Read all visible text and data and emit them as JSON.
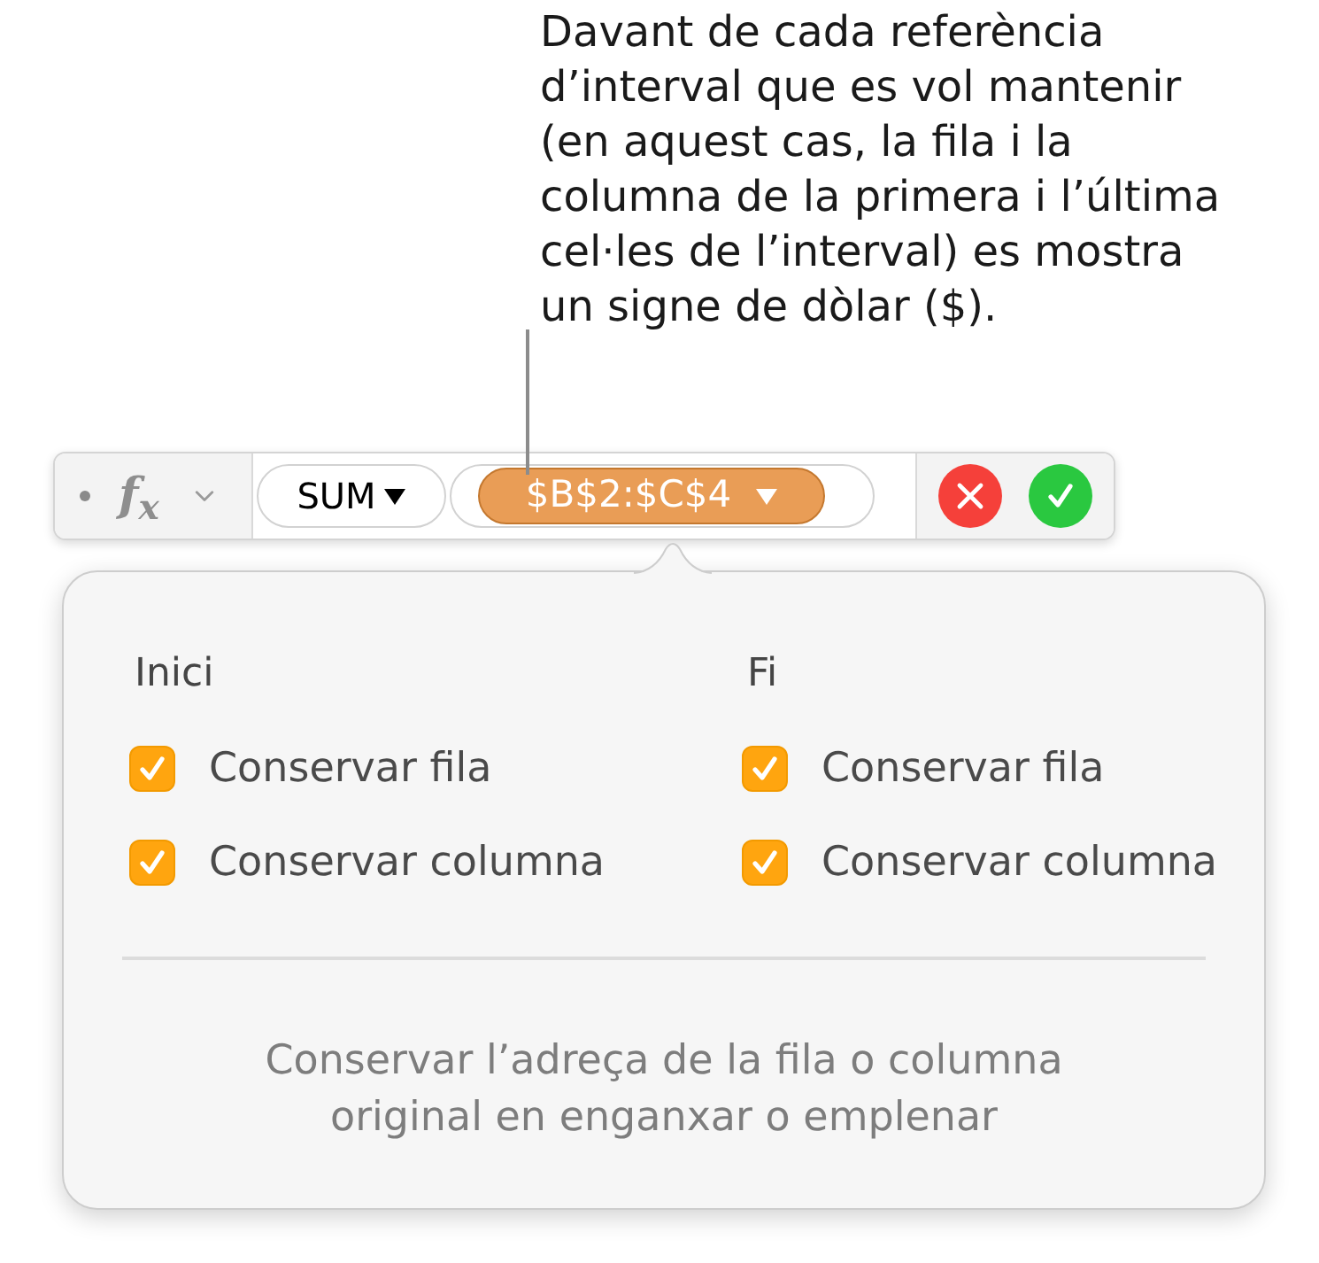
{
  "callout": {
    "text": "Davant de cada referència d’interval que es vol mantenir (en aquest cas, la fila i la columna de la primera i l’última cel·les de l’interval) es mostra un signe de dòlar ($)."
  },
  "formula_bar": {
    "function_symbol": "f$_{x}$",
    "function_name": "SUM",
    "range_token": {
      "text": "$B$2:$C$4",
      "selected": true
    }
  },
  "popover": {
    "columns": [
      {
        "heading": "Inici",
        "options": [
          {
            "label": "Conservar fila",
            "checked": true
          },
          {
            "label": "Conservar columna",
            "checked": true
          }
        ]
      },
      {
        "heading": "Fi",
        "options": [
          {
            "label": "Conservar fila",
            "checked": true
          },
          {
            "label": "Conservar columna",
            "checked": true
          }
        ]
      }
    ],
    "description": "Conservar l’adreça de la fila o columna original en enganxar o emplenar"
  }
}
